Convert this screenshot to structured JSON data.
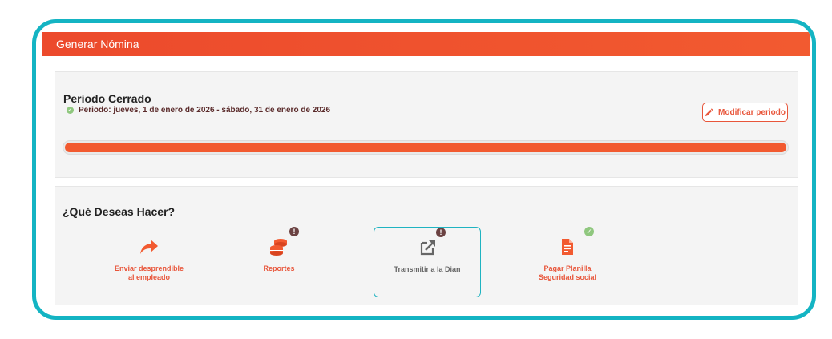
{
  "header": {
    "title": "Generar Nómina"
  },
  "period": {
    "title": "Periodo Cerrado",
    "range_text": "Periodo: jueves, 1 de enero de 2026 - sábado, 31 de enero de 2026",
    "modify_label": "Modificar periodo",
    "progress_percent": 100
  },
  "actions_section": {
    "title": "¿Qué Deseas Hacer?",
    "items": [
      {
        "label": "Enviar desprendible al empleado",
        "icon": "share-arrow-icon",
        "badge": null
      },
      {
        "label": "Reportes",
        "icon": "coins-stack-icon",
        "badge": "warning"
      },
      {
        "label": "Transmitir a la Dian",
        "icon": "external-link-icon",
        "badge": "warning",
        "selected": true
      },
      {
        "label": "Pagar Planilla Seguridad social",
        "icon": "document-icon",
        "badge": "ok"
      }
    ]
  },
  "colors": {
    "accent": "#f25a30",
    "frame": "#14b4c3",
    "success": "#8fc77e",
    "warning_badge": "#6b4242"
  }
}
